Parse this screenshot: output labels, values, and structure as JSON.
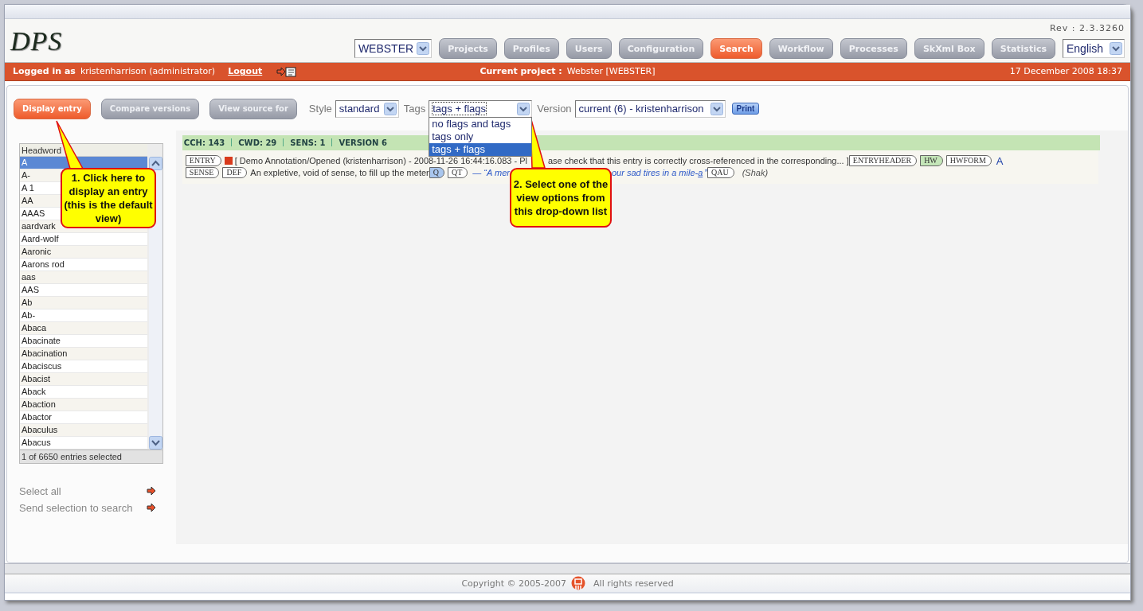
{
  "header": {
    "logo": "DPS",
    "revision": "Rev : 2.3.3260",
    "project_select": "WEBSTER",
    "language_select": "English",
    "nav": [
      {
        "label": "Projects",
        "selected": false
      },
      {
        "label": "Profiles",
        "selected": false
      },
      {
        "label": "Users",
        "selected": false
      },
      {
        "label": "Configuration",
        "selected": false
      },
      {
        "label": "Search",
        "selected": true
      },
      {
        "label": "Workflow",
        "selected": false
      },
      {
        "label": "Processes",
        "selected": false
      },
      {
        "label": "SkXml Box",
        "selected": false
      },
      {
        "label": "Statistics",
        "selected": false
      }
    ]
  },
  "user_bar": {
    "logged_in_label": "Logged in as",
    "user": "kristenharrison (administrator)",
    "logout": "Logout",
    "project_label": "Current project :",
    "project": "Webster [WEBSTER]",
    "datetime": "17 December 2008 18:37"
  },
  "toolbar": {
    "buttons": [
      {
        "label": "Display entry",
        "selected": true
      },
      {
        "label": "Compare versions",
        "selected": false
      },
      {
        "label": "View source for",
        "selected": false
      }
    ],
    "style_label": "Style",
    "style_value": "standard",
    "tags_label": "Tags",
    "tags_value": "tags + flags",
    "tags_expanded": true,
    "tags_options": [
      {
        "label": "no flags and tags",
        "selected": false
      },
      {
        "label": "tags only",
        "selected": false
      },
      {
        "label": "tags + flags",
        "selected": true
      }
    ],
    "version_label": "Version",
    "version_value": "current (6) - kristenharrison",
    "print": "Print"
  },
  "headwords": {
    "column": "Headword",
    "status": "1 of 6650 entries selected",
    "rows": [
      {
        "text": "A",
        "selected": true
      },
      {
        "text": "A-",
        "selected": false
      },
      {
        "text": "A 1",
        "selected": false
      },
      {
        "text": "AA",
        "selected": false
      },
      {
        "text": "AAAS",
        "selected": false
      },
      {
        "text": "aardvark",
        "selected": false
      },
      {
        "text": "Aard-wolf",
        "selected": false
      },
      {
        "text": "Aaronic",
        "selected": false
      },
      {
        "text": "Aarons rod",
        "selected": false
      },
      {
        "text": "aas",
        "selected": false
      },
      {
        "text": "AAS",
        "selected": false
      },
      {
        "text": "Ab",
        "selected": false
      },
      {
        "text": "Ab-",
        "selected": false
      },
      {
        "text": "Abaca",
        "selected": false
      },
      {
        "text": "Abacinate",
        "selected": false
      },
      {
        "text": "Abacination",
        "selected": false
      },
      {
        "text": "Abaciscus",
        "selected": false
      },
      {
        "text": "Abacist",
        "selected": false
      },
      {
        "text": "Aback",
        "selected": false
      },
      {
        "text": "Abaction",
        "selected": false
      },
      {
        "text": "Abactor",
        "selected": false
      },
      {
        "text": "Abaculus",
        "selected": false
      },
      {
        "text": "Abacus",
        "selected": false
      }
    ]
  },
  "links": [
    "Select all",
    "Send selection to search"
  ],
  "entry": {
    "stats": [
      "CCH: 143",
      "CWD: 29",
      "SENS: 1",
      "VERSION 6"
    ],
    "lines": [
      [
        {
          "kind": "tag",
          "text": "ENTRY",
          "color": "#ffffff"
        },
        {
          "kind": "flag",
          "color": "#d83a1c"
        },
        {
          "kind": "text",
          "text": "[ Demo Annotation/Opened (kristenharrison) - 2008-11-26 16:44:16.083 - Pl"
        },
        {
          "kind": "pointer"
        },
        {
          "kind": "text",
          "text": "ase check that this entry is correctly cross-referenced in the corresponding... ]"
        },
        {
          "kind": "tag",
          "text": "ENTRYHEADER",
          "color": "#ffffff"
        },
        {
          "kind": "tag",
          "text": "HW",
          "color": "#c4e6b8"
        },
        {
          "kind": "tag",
          "text": "HWFORM",
          "color": "#ffffff"
        },
        {
          "kind": "headword",
          "text": "A"
        }
      ],
      [
        {
          "kind": "tag",
          "text": "SENSE",
          "color": "#ffffff"
        },
        {
          "kind": "tag",
          "text": "DEF",
          "color": "#ffffff"
        },
        {
          "kind": "text",
          "text": "An expletive, void of sense, to fill up the meter"
        },
        {
          "kind": "tag",
          "text": "Q",
          "color": "#a9c6ee"
        },
        {
          "kind": "tag",
          "text": "QT",
          "color": "#ffffff"
        },
        {
          "kind": "quote",
          "text": "— “A mer"
        },
        {
          "kind": "hidden"
        },
        {
          "kind": "quote",
          "text": "our sad tires in a mile-"
        },
        {
          "kind": "link",
          "text": "a"
        },
        {
          "kind": "quote",
          "text": "”"
        },
        {
          "kind": "tag",
          "text": "QAU",
          "color": "#ffffff"
        },
        {
          "kind": "author",
          "text": "(Shak)"
        }
      ]
    ]
  },
  "callouts": [
    "1. Click here to display an entry (this is the default view)",
    "2. Select one of the view options from this drop-down list"
  ],
  "footer": {
    "copyright": "Copyright © 2005-2007",
    "rights": "All rights reserved"
  }
}
